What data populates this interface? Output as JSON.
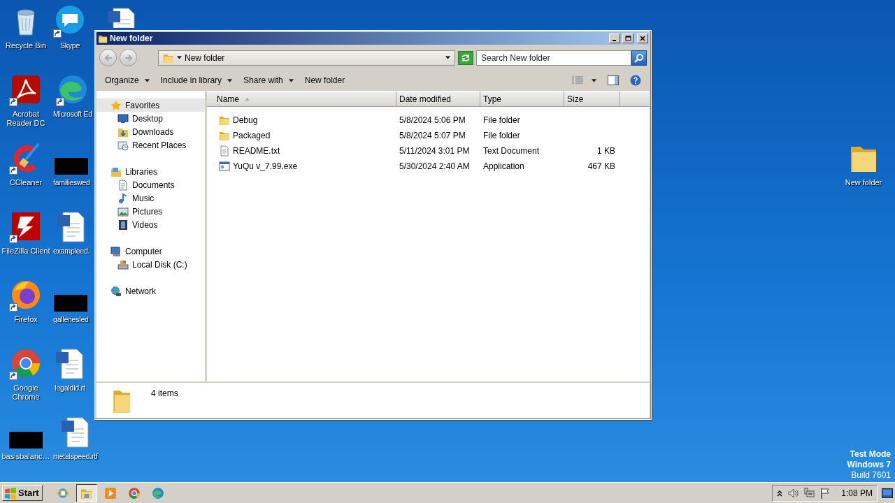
{
  "desktop": {
    "icons": [
      {
        "label": "Recycle Bin",
        "kind": "recycle",
        "shortcut": false
      },
      {
        "label": "Acrobat\nReader DC",
        "kind": "acrobat",
        "shortcut": true
      },
      {
        "label": "CCleaner",
        "kind": "ccleaner",
        "shortcut": true
      },
      {
        "label": "FileZilla Client",
        "kind": "filezilla",
        "shortcut": true
      },
      {
        "label": "Firefox",
        "kind": "firefox",
        "shortcut": true
      },
      {
        "label": "Google\nChrome",
        "kind": "chrome",
        "shortcut": true
      },
      {
        "label": "basisbalanc…",
        "kind": "black",
        "shortcut": false
      },
      {
        "label": "Skype",
        "kind": "skype",
        "shortcut": true
      },
      {
        "label": "Microsoft Ed",
        "kind": "edge",
        "shortcut": true
      },
      {
        "label": "familieswed",
        "kind": "black",
        "shortcut": false
      },
      {
        "label": "exampleed.",
        "kind": "doc",
        "shortcut": false
      },
      {
        "label": "galleriesled",
        "kind": "black",
        "shortcut": false
      },
      {
        "label": "legaldid.rt",
        "kind": "doc",
        "shortcut": false
      },
      {
        "label": "metalspeed.rtf",
        "kind": "doc",
        "shortcut": false
      },
      {
        "kind": "doc",
        "shortcut": false
      }
    ],
    "right_icons": [
      {
        "label": "New folder",
        "kind": "folder",
        "shortcut": false
      }
    ],
    "notice": [
      "Test Mode",
      "Windows 7",
      "Build 7601"
    ]
  },
  "window": {
    "title": "New folder",
    "nav_buttons": [
      {
        "kind": "back",
        "disabled": true
      },
      {
        "kind": "forward",
        "disabled": true
      }
    ],
    "address": "New folder",
    "search": {
      "placeholder": "Search New folder"
    },
    "toolbar": [
      {
        "label": "Organize",
        "menu": true
      },
      {
        "label": "Include in library",
        "menu": true
      },
      {
        "label": "Share with",
        "menu": true
      },
      {
        "label": "New folder",
        "menu": false
      }
    ],
    "navigation": [
      {
        "label": "Favorites",
        "kind": "star",
        "selected": true,
        "children": [
          {
            "label": "Desktop",
            "kind": "desktop",
            "selected": false
          },
          {
            "label": "Downloads",
            "kind": "downloads",
            "selected": false
          },
          {
            "label": "Recent Places",
            "kind": "recent",
            "selected": false
          }
        ]
      },
      {
        "label": "Libraries",
        "kind": "libraries",
        "selected": false,
        "children": [
          {
            "label": "Documents",
            "kind": "documents",
            "selected": false
          },
          {
            "label": "Music",
            "kind": "music",
            "selected": false
          },
          {
            "label": "Pictures",
            "kind": "pictures",
            "selected": false
          },
          {
            "label": "Videos",
            "kind": "videos",
            "selected": false
          }
        ]
      },
      {
        "label": "Computer",
        "kind": "computer",
        "selected": false,
        "children": [
          {
            "label": "Local Disk (C:)",
            "kind": "disk",
            "selected": false
          }
        ]
      },
      {
        "label": "Network",
        "kind": "network",
        "selected": false
      }
    ],
    "table": {
      "columns": [
        {
          "label": "Name",
          "sorted": true
        },
        {
          "label": "Date modified",
          "sorted": false
        },
        {
          "label": "Type",
          "sorted": false
        },
        {
          "label": "Size",
          "sorted": false
        }
      ],
      "rows": [
        {
          "kind": "folder",
          "name": "Debug",
          "date": "5/8/2024 5:06 PM",
          "type": "File folder"
        },
        {
          "kind": "folder",
          "name": "Packaged",
          "date": "5/8/2024 5:07 PM",
          "type": "File folder"
        },
        {
          "kind": "text",
          "name": "README.txt",
          "date": "5/11/2024 3:01 PM",
          "type": "Text Document",
          "size": "1 KB"
        },
        {
          "kind": "app",
          "name": "YuQu v_7.99.exe",
          "date": "5/30/2024 2:40 AM",
          "type": "Application",
          "size": "467 KB"
        }
      ]
    },
    "status": "4 items"
  },
  "taskbar": {
    "start": "Start",
    "apps": [
      {
        "kind": "ie",
        "active": false
      },
      {
        "kind": "explorer",
        "active": true
      },
      {
        "kind": "media",
        "active": false
      },
      {
        "kind": "chrome",
        "active": false
      },
      {
        "kind": "edge",
        "active": false
      }
    ],
    "clock": "1:08 PM"
  }
}
